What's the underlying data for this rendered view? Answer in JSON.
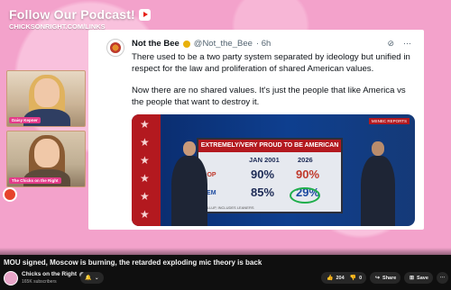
{
  "promo": {
    "title": "Follow Our Podcast!",
    "url": "CHICKSONRIGHT.COM/LINKS"
  },
  "cams": [
    {
      "label": "Daisy Kepner"
    },
    {
      "label": "The Chicks on the Right"
    }
  ],
  "tweet": {
    "name": "Not the Bee",
    "handle": "@Not_the_Bee",
    "time": "· 6h",
    "para1": "There used to be a two party system separated by ideology but unified in respect for the law and proliferation of shared American values.",
    "para2": "Now there are no shared values. It's just the people that like America vs the people that want to destroy it."
  },
  "news": {
    "tag": "MSNBC REPORTS",
    "board_title": "EXTREMELY/VERY PROUD TO BE AMERICAN",
    "col1": "JAN 2001",
    "col2": "2026",
    "rows": [
      {
        "party": "GOP",
        "v1": "90%",
        "v2": "90%"
      },
      {
        "party": "DEM",
        "v1": "85%",
        "v2": "29%"
      }
    ],
    "foot": "GALLUP, INCLUDES LEANERS"
  },
  "video": {
    "title": "MOU signed, Moscow is burning, the retarded exploding mic theory is back"
  },
  "channel": {
    "name": "Chicks on the Right",
    "subs": "165K subscribers"
  },
  "actions": {
    "likes": "204",
    "dislikes": "0",
    "share": "Share",
    "save": "Save",
    "more": "⋯"
  },
  "colors": {
    "accent_pink": "#f3a2cb",
    "tweet_bg": "#ffffff",
    "page_bg": "#0f0f0f"
  }
}
